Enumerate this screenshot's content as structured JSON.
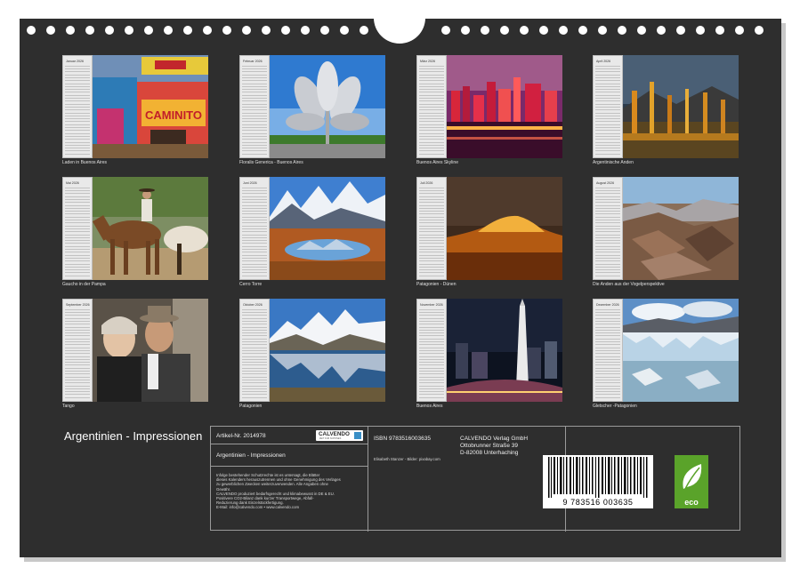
{
  "calendar_title": "Argentinien - Impressionen",
  "months": [
    {
      "name": "Januar 2026",
      "caption": "Laden in Buenos Aires"
    },
    {
      "name": "Februar 2026",
      "caption": "Floralis Generica - Buenos Aires"
    },
    {
      "name": "März 2026",
      "caption": "Buenos Aires Skyline"
    },
    {
      "name": "April 2026",
      "caption": "Argentinische Anden"
    },
    {
      "name": "Mai 2026",
      "caption": "Gaucho in der Pampa"
    },
    {
      "name": "Juni 2026",
      "caption": "Cerro Torre"
    },
    {
      "name": "Juli 2026",
      "caption": "Patagonien - Dünen"
    },
    {
      "name": "August 2026",
      "caption": "Die Anden aus der Vogelperspektive"
    },
    {
      "name": "September 2026",
      "caption": "Tango"
    },
    {
      "name": "Oktober 2026",
      "caption": "Patagonien"
    },
    {
      "name": "November 2026",
      "caption": "Buenos Aires"
    },
    {
      "name": "Dezember 2026",
      "caption": "Gletscher -Patagonien"
    }
  ],
  "info": {
    "article_no": "Artikel-Nr. 2014978",
    "title": "Argentinien - Impressionen",
    "isbn": "ISBN 9783516003635",
    "publisher": [
      "CALVENDO Verlag GmbH",
      "Ottobrunner Straße 39",
      "D-82008 Unterhaching"
    ],
    "credit": "Elisabeth Stanzer - Bilder: pixabay.com",
    "legal": [
      "Infolge bestehender Schutzrechte ist es untersagt, die Blätter",
      "dieses Kalenders herauszutrennen und ohne Genehmigung des Verlages",
      "zu gewerblichen Zwecken weiterzuverwenden. Alle Angaben ohne",
      "Gewähr.",
      "CALVENDO produziert bedarfsgerecht und klimabewusst in DE & EU.",
      "Positivere CO2-Bilanz dank kurzer Transportwege, Abfall-",
      "Reduzierung dank Einzelstückfertigung.",
      "E-Mail: info@calvendo.com • www.calvendo.com"
    ],
    "logo_text": "CALVENDO",
    "logo_sub": "ZEIT FÜR SCHÖNES",
    "barcode_number": "9 783516 003635",
    "eco_label": "eco"
  }
}
